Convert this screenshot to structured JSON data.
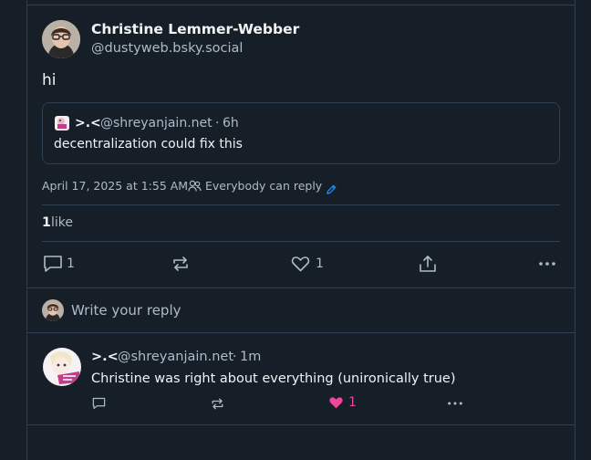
{
  "post": {
    "author": {
      "display_name": "Christine Lemmer-Webber",
      "handle": "@dustyweb.bsky.social"
    },
    "text": "hi",
    "quote": {
      "author_name": ">.<",
      "handle": "@shreyanjain.net",
      "separator": "·",
      "time": "6h",
      "text": "decentralization could fix this"
    },
    "timestamp": "April 17, 2025 at 1:55 AM",
    "reply_setting": "Everybody can reply",
    "likes": {
      "count": "1",
      "label": "like"
    },
    "actions": {
      "reply_count": "1",
      "repost_count": "",
      "like_count": "1"
    }
  },
  "composer": {
    "placeholder": "Write your reply"
  },
  "reply": {
    "author_name": ">.<",
    "handle": "@shreyanjain.net",
    "separator": "·",
    "time": "1m",
    "text": "Christine was right about everything (unironically true)",
    "actions": {
      "like_count": "1",
      "liked": true
    }
  },
  "colors": {
    "background": "#161e27",
    "border": "#2e4052",
    "text": "#f1f3f5",
    "muted": "#aebbc9",
    "accent": "#208bfe",
    "like_active": "#ec4899"
  },
  "icons": [
    "reply-icon",
    "repost-icon",
    "heart-icon",
    "share-icon",
    "more-icon",
    "people-icon",
    "pencil-icon"
  ]
}
